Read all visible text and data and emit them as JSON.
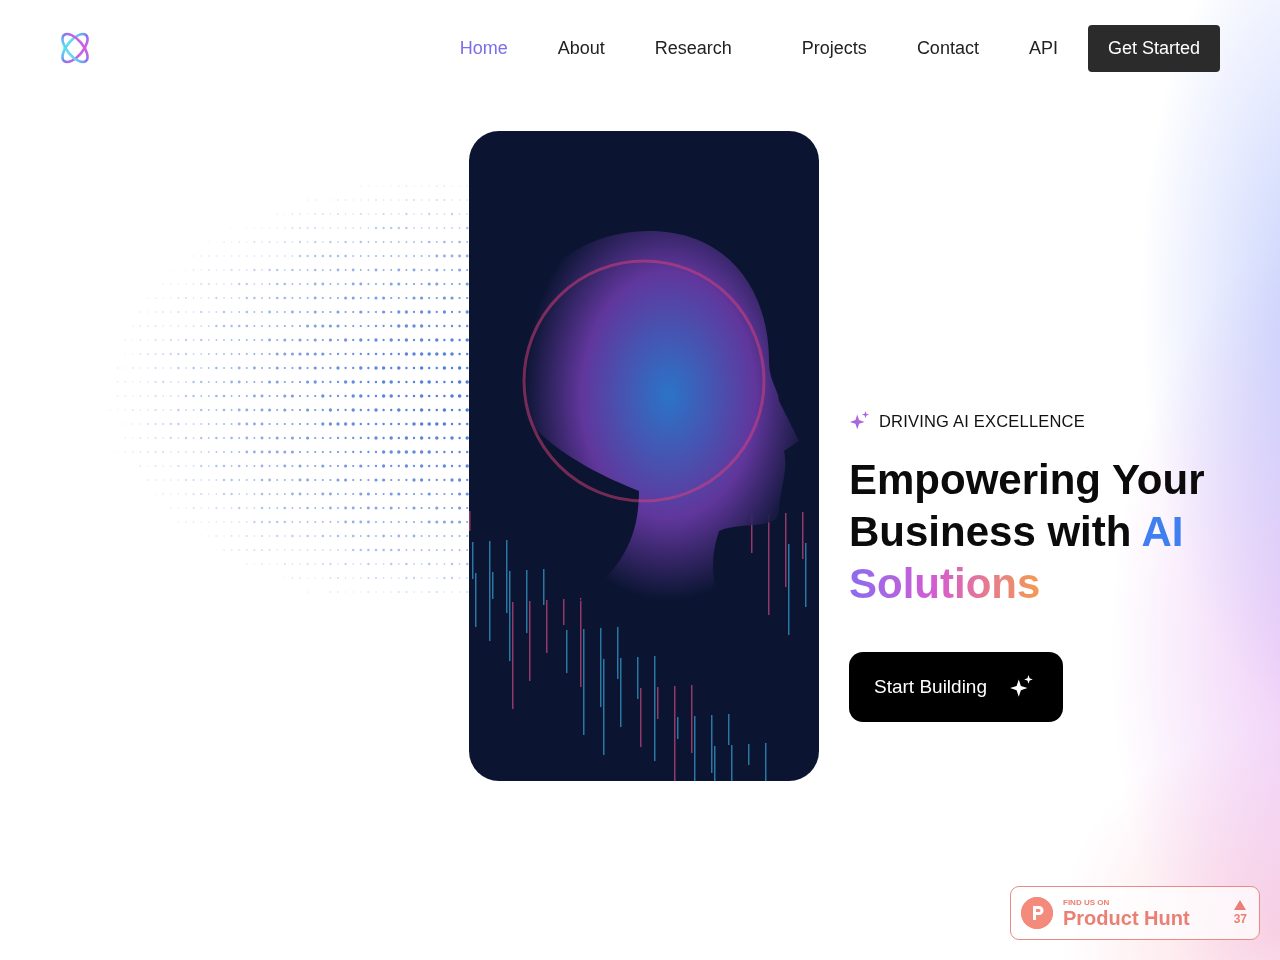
{
  "nav": {
    "items": [
      {
        "label": "Home",
        "selected": true
      },
      {
        "label": "About",
        "selected": false
      },
      {
        "label": "Research",
        "selected": false
      },
      {
        "label": "Projects",
        "selected": false
      },
      {
        "label": "Contact",
        "selected": false
      },
      {
        "label": "API",
        "selected": false
      }
    ],
    "cta": "Get Started"
  },
  "hero": {
    "eyebrow": "DRIVING AI EXCELLENCE",
    "heading": [
      {
        "text": "Empowering Your Business with ",
        "kind": "plain"
      },
      {
        "text": "AI ",
        "kind": "accent"
      },
      {
        "text": "Solutions",
        "kind": "gradient"
      }
    ],
    "button": "Start Building"
  },
  "badge": {
    "caption": "FIND US ON",
    "name": "Product Hunt",
    "votes": "37"
  }
}
